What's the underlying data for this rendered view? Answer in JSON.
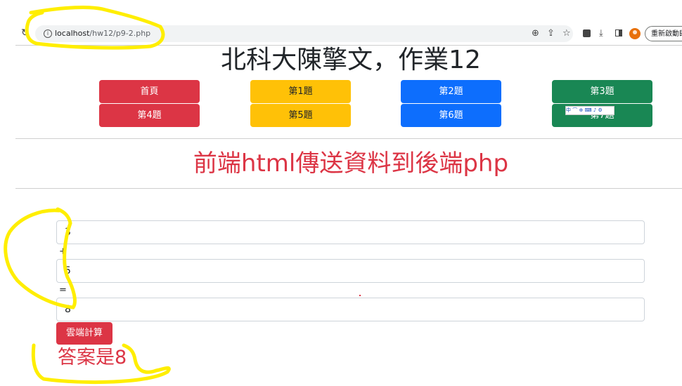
{
  "browser": {
    "url_host": "localhost",
    "url_path": "/hw12/p9-2.php",
    "restart_label": "重新啟動即"
  },
  "page": {
    "title": "北科大陳擎文，作業12",
    "subtitle": "前端html傳送資料到後端php"
  },
  "nav": {
    "home": "首頁",
    "q1": "第1題",
    "q2": "第2題",
    "q3": "第3題",
    "q4": "第4題",
    "q5": "第5題",
    "q6": "第6題",
    "q7": "第7題"
  },
  "ime_toolbar": "中 ⌒ ⊕ ⌨ ♪ ⚙",
  "form": {
    "operand1": "3",
    "plus": "+",
    "operand2": "5",
    "equals": "=",
    "result": "8",
    "calc_button": "雲端計算"
  },
  "answer": "答案是8",
  "colors": {
    "danger": "#dc3545",
    "warning": "#ffc107",
    "primary": "#0d6efd",
    "success": "#198754",
    "highlighter": "#ffee00"
  }
}
